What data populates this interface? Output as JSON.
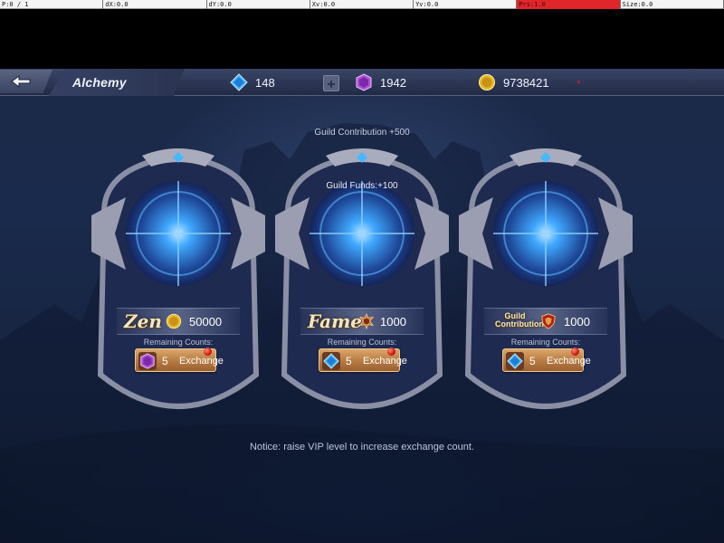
{
  "debug_bar": {
    "cells": [
      "P:0 / 1",
      "dX:0.0",
      "dY:0.0",
      "Xv:0.0",
      "Yv:0.0",
      "Prs:1.0",
      "Size:0.0"
    ],
    "alert_color": "#e0262a"
  },
  "header": {
    "title": "Alchemy",
    "diamonds": "148",
    "gems": "1942",
    "gold": "9738421"
  },
  "guild": {
    "contribution": "Guild Contribution +500",
    "funds": "Guild Funds:+100"
  },
  "cards": [
    {
      "reward_name": "Zen",
      "reward_icon": "gold-coin-icon",
      "reward_amount": "50000",
      "remaining_label": "Remaining Counts:",
      "cost_icon": "purple-gem-icon",
      "count": "5",
      "button_label": "Exchange"
    },
    {
      "reward_name": "Fame",
      "reward_icon": "fame-medal-icon",
      "reward_amount": "1000",
      "remaining_label": "Remaining Counts:",
      "cost_icon": "blue-diamond-icon",
      "count": "5",
      "button_label": "Exchange"
    },
    {
      "reward_name": "Guild Contribution",
      "reward_icon": "guild-shield-icon",
      "reward_amount": "1000",
      "remaining_label": "Remaining Counts:",
      "cost_icon": "blue-diamond-icon",
      "count": "5",
      "button_label": "Exchange"
    }
  ],
  "notice": "Notice: raise VIP level to increase exchange count.",
  "colors": {
    "accent_blue": "#3fa8ff",
    "button_orange": "#b77a42",
    "notification_red": "#d1170d",
    "gold": "#e7b81f"
  }
}
